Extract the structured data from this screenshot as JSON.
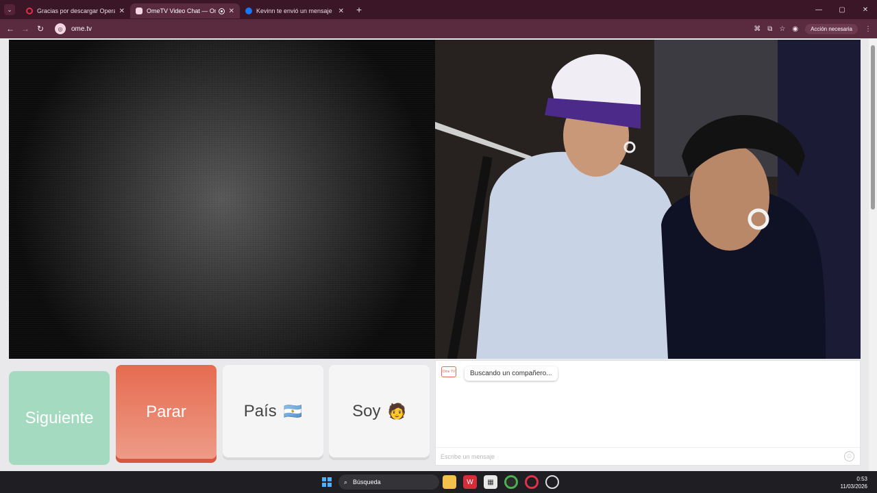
{
  "browser": {
    "tabs": [
      {
        "title": "Gracias por descargar Opera",
        "favicon": "opera-icon"
      },
      {
        "title": "OmeTV Video Chat — Ome",
        "favicon": "ometv-icon"
      },
      {
        "title": "Kevinn te envió un mensaje",
        "favicon": "facebook-icon"
      }
    ],
    "url": "ome.tv",
    "action_pill": "Acción necesaria"
  },
  "buttons": {
    "next": "Siguiente",
    "stop": "Parar",
    "country": "País",
    "country_flag": "🇦🇷",
    "me": "Soy",
    "me_emoji": "🧑"
  },
  "chat": {
    "status": "Buscando un compañero...",
    "placeholder": "Escribe un mensaje",
    "logo_text": "Ome TV"
  },
  "taskbar": {
    "search": "Búsqueda",
    "time": "0:53",
    "date": "11/03/2026"
  }
}
